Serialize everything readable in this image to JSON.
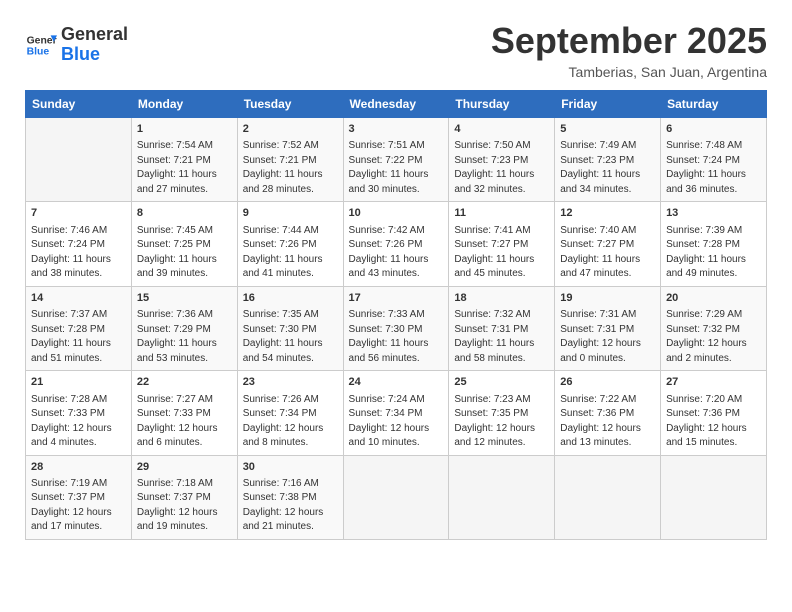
{
  "header": {
    "logo_line1": "General",
    "logo_line2": "Blue",
    "month": "September 2025",
    "location": "Tamberias, San Juan, Argentina"
  },
  "weekdays": [
    "Sunday",
    "Monday",
    "Tuesday",
    "Wednesday",
    "Thursday",
    "Friday",
    "Saturday"
  ],
  "weeks": [
    [
      {
        "day": "",
        "empty": true
      },
      {
        "day": "1",
        "sunrise": "Sunrise: 7:54 AM",
        "sunset": "Sunset: 7:21 PM",
        "daylight": "Daylight: 11 hours and 27 minutes."
      },
      {
        "day": "2",
        "sunrise": "Sunrise: 7:52 AM",
        "sunset": "Sunset: 7:21 PM",
        "daylight": "Daylight: 11 hours and 28 minutes."
      },
      {
        "day": "3",
        "sunrise": "Sunrise: 7:51 AM",
        "sunset": "Sunset: 7:22 PM",
        "daylight": "Daylight: 11 hours and 30 minutes."
      },
      {
        "day": "4",
        "sunrise": "Sunrise: 7:50 AM",
        "sunset": "Sunset: 7:23 PM",
        "daylight": "Daylight: 11 hours and 32 minutes."
      },
      {
        "day": "5",
        "sunrise": "Sunrise: 7:49 AM",
        "sunset": "Sunset: 7:23 PM",
        "daylight": "Daylight: 11 hours and 34 minutes."
      },
      {
        "day": "6",
        "sunrise": "Sunrise: 7:48 AM",
        "sunset": "Sunset: 7:24 PM",
        "daylight": "Daylight: 11 hours and 36 minutes."
      }
    ],
    [
      {
        "day": "7",
        "sunrise": "Sunrise: 7:46 AM",
        "sunset": "Sunset: 7:24 PM",
        "daylight": "Daylight: 11 hours and 38 minutes."
      },
      {
        "day": "8",
        "sunrise": "Sunrise: 7:45 AM",
        "sunset": "Sunset: 7:25 PM",
        "daylight": "Daylight: 11 hours and 39 minutes."
      },
      {
        "day": "9",
        "sunrise": "Sunrise: 7:44 AM",
        "sunset": "Sunset: 7:26 PM",
        "daylight": "Daylight: 11 hours and 41 minutes."
      },
      {
        "day": "10",
        "sunrise": "Sunrise: 7:42 AM",
        "sunset": "Sunset: 7:26 PM",
        "daylight": "Daylight: 11 hours and 43 minutes."
      },
      {
        "day": "11",
        "sunrise": "Sunrise: 7:41 AM",
        "sunset": "Sunset: 7:27 PM",
        "daylight": "Daylight: 11 hours and 45 minutes."
      },
      {
        "day": "12",
        "sunrise": "Sunrise: 7:40 AM",
        "sunset": "Sunset: 7:27 PM",
        "daylight": "Daylight: 11 hours and 47 minutes."
      },
      {
        "day": "13",
        "sunrise": "Sunrise: 7:39 AM",
        "sunset": "Sunset: 7:28 PM",
        "daylight": "Daylight: 11 hours and 49 minutes."
      }
    ],
    [
      {
        "day": "14",
        "sunrise": "Sunrise: 7:37 AM",
        "sunset": "Sunset: 7:28 PM",
        "daylight": "Daylight: 11 hours and 51 minutes."
      },
      {
        "day": "15",
        "sunrise": "Sunrise: 7:36 AM",
        "sunset": "Sunset: 7:29 PM",
        "daylight": "Daylight: 11 hours and 53 minutes."
      },
      {
        "day": "16",
        "sunrise": "Sunrise: 7:35 AM",
        "sunset": "Sunset: 7:30 PM",
        "daylight": "Daylight: 11 hours and 54 minutes."
      },
      {
        "day": "17",
        "sunrise": "Sunrise: 7:33 AM",
        "sunset": "Sunset: 7:30 PM",
        "daylight": "Daylight: 11 hours and 56 minutes."
      },
      {
        "day": "18",
        "sunrise": "Sunrise: 7:32 AM",
        "sunset": "Sunset: 7:31 PM",
        "daylight": "Daylight: 11 hours and 58 minutes."
      },
      {
        "day": "19",
        "sunrise": "Sunrise: 7:31 AM",
        "sunset": "Sunset: 7:31 PM",
        "daylight": "Daylight: 12 hours and 0 minutes."
      },
      {
        "day": "20",
        "sunrise": "Sunrise: 7:29 AM",
        "sunset": "Sunset: 7:32 PM",
        "daylight": "Daylight: 12 hours and 2 minutes."
      }
    ],
    [
      {
        "day": "21",
        "sunrise": "Sunrise: 7:28 AM",
        "sunset": "Sunset: 7:33 PM",
        "daylight": "Daylight: 12 hours and 4 minutes."
      },
      {
        "day": "22",
        "sunrise": "Sunrise: 7:27 AM",
        "sunset": "Sunset: 7:33 PM",
        "daylight": "Daylight: 12 hours and 6 minutes."
      },
      {
        "day": "23",
        "sunrise": "Sunrise: 7:26 AM",
        "sunset": "Sunset: 7:34 PM",
        "daylight": "Daylight: 12 hours and 8 minutes."
      },
      {
        "day": "24",
        "sunrise": "Sunrise: 7:24 AM",
        "sunset": "Sunset: 7:34 PM",
        "daylight": "Daylight: 12 hours and 10 minutes."
      },
      {
        "day": "25",
        "sunrise": "Sunrise: 7:23 AM",
        "sunset": "Sunset: 7:35 PM",
        "daylight": "Daylight: 12 hours and 12 minutes."
      },
      {
        "day": "26",
        "sunrise": "Sunrise: 7:22 AM",
        "sunset": "Sunset: 7:36 PM",
        "daylight": "Daylight: 12 hours and 13 minutes."
      },
      {
        "day": "27",
        "sunrise": "Sunrise: 7:20 AM",
        "sunset": "Sunset: 7:36 PM",
        "daylight": "Daylight: 12 hours and 15 minutes."
      }
    ],
    [
      {
        "day": "28",
        "sunrise": "Sunrise: 7:19 AM",
        "sunset": "Sunset: 7:37 PM",
        "daylight": "Daylight: 12 hours and 17 minutes."
      },
      {
        "day": "29",
        "sunrise": "Sunrise: 7:18 AM",
        "sunset": "Sunset: 7:37 PM",
        "daylight": "Daylight: 12 hours and 19 minutes."
      },
      {
        "day": "30",
        "sunrise": "Sunrise: 7:16 AM",
        "sunset": "Sunset: 7:38 PM",
        "daylight": "Daylight: 12 hours and 21 minutes."
      },
      {
        "day": "",
        "empty": true
      },
      {
        "day": "",
        "empty": true
      },
      {
        "day": "",
        "empty": true
      },
      {
        "day": "",
        "empty": true
      }
    ]
  ]
}
